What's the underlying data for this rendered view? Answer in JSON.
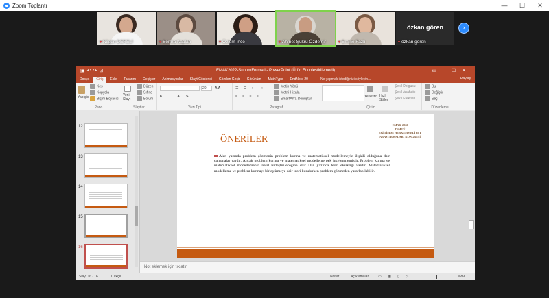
{
  "zoom": {
    "title": "Zoom Toplantı",
    "window_controls": [
      "—",
      "☐",
      "✕"
    ],
    "participants": [
      {
        "name": "Nilgün DERELİ",
        "muted": true
      },
      {
        "name": "Semra Kaplan",
        "muted": true
      },
      {
        "name": "Özlem İnce",
        "muted": true
      },
      {
        "name": "Ahmet Şükrü Özdemir",
        "muted": true,
        "active_speaker": true
      },
      {
        "name": "Emine Fazlı",
        "muted": true
      },
      {
        "name": "özkan gören",
        "display_text": "özkan gören",
        "muted": true
      }
    ],
    "next_icon": "chevron-right-icon"
  },
  "powerpoint": {
    "document_title": "EMAK2022-SunumFormati - PowerPoint (Ürün Etkinleştirilemedi)",
    "tabs": [
      "Dosya",
      "Giriş",
      "Ekle",
      "Tasarım",
      "Geçişler",
      "Animasyonlar",
      "Slayt Gösterisi",
      "Gözden Geçir",
      "Görünüm",
      "MathType",
      "EndNote 20"
    ],
    "active_tab": "Giriş",
    "tell_me": "Ne yapmak istediğinizi söyleyin...",
    "share": "Paylaş",
    "ribbon": {
      "clipboard": {
        "paste": "Yapıştır",
        "cut": "Kes",
        "copy": "Kopyala",
        "format_painter": "Biçim Boyacısı",
        "label": "Pano"
      },
      "slides": {
        "new_slide": "Yeni Slayt",
        "layout": "Düzen",
        "reset": "Sıfırla",
        "section": "Bölüm",
        "label": "Slaytlar"
      },
      "font": {
        "font_name": "",
        "font_size": "20",
        "label": "Yazı Tipi"
      },
      "paragraph": {
        "text_direction": "Metin Yönü",
        "align_text": "Metni Hizala",
        "smartart": "SmartArt'a Dönüştür",
        "label": "Paragraf"
      },
      "drawing": {
        "arrange": "Yerleştir",
        "quick_styles": "Hızlı Stiller",
        "shape_fill": "Şekil Dolgusu",
        "shape_outline": "Şekil Anahattı",
        "shape_effects": "Şekil Efektleri",
        "label": "Çizim"
      },
      "editing": {
        "find": "Bul",
        "replace": "Değiştir",
        "select": "Seç",
        "label": "Düzenleme"
      }
    },
    "thumbnails": [
      {
        "number": "12"
      },
      {
        "number": "13"
      },
      {
        "number": "14"
      },
      {
        "number": "15",
        "hover": true
      },
      {
        "number": "16",
        "selected": true
      }
    ],
    "slide": {
      "title": "ÖNERİLER",
      "logo_lines": [
        "EMAK-2022",
        "FSMVÜ",
        "EĞİTİMDE HERKEMMELİYET",
        "ARAŞTIRMALARI KONGRESİ"
      ],
      "body": "Alan yazında problem çözmenin problem kurma ve matematiksel modellemeyle ilişkili olduğuna dair çalışmalar vardır. Ancak problem kurma ve matematiksel modelleme pek incelenmemiştir. Problem kurma ve matematiksel modellemenin nasıl birleştirileceğine dair alan yazında teori eksikliği vardır. Matematiksel modelleme ve problem kurmayı birleştirmeye dair teori kurulurken problem çözmeden yararlanılabilir."
    },
    "notes_placeholder": "Not eklemek için tıklatın",
    "status": {
      "slide_counter": "Slayt 16 / 16",
      "language": "Türkçe",
      "notes": "Notlar",
      "comments": "Açıklamalar",
      "zoom": "%89"
    },
    "accent_color": "#b7472a",
    "slide_accent": "#c55a11"
  }
}
